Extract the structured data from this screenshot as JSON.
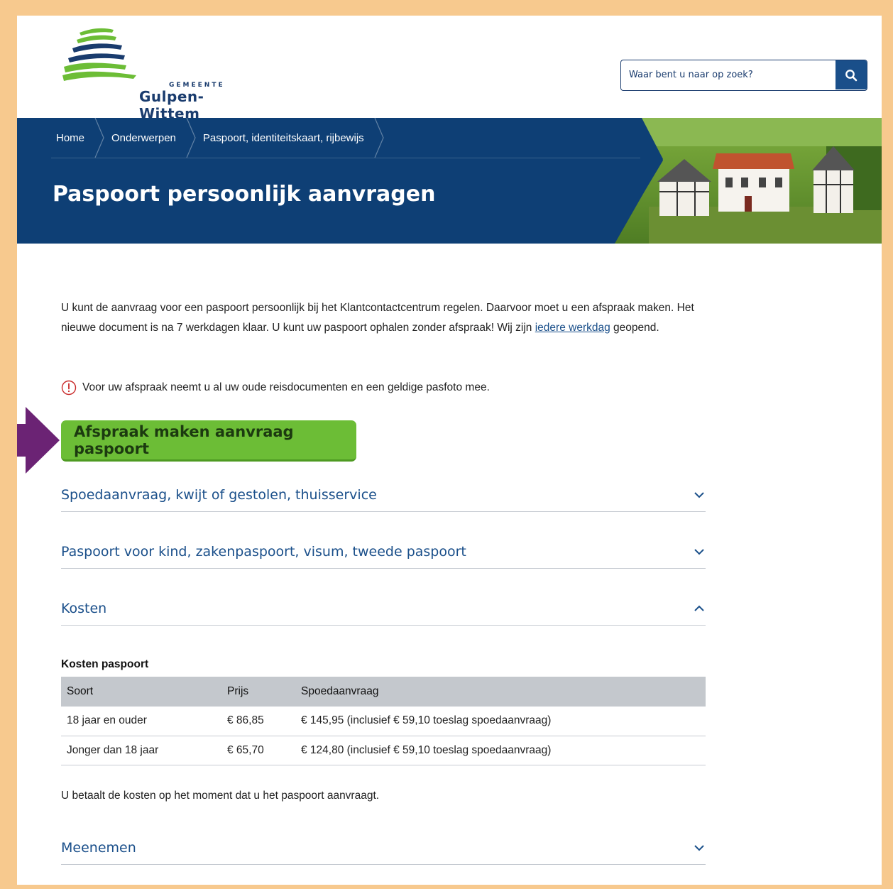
{
  "logo": {
    "gemeente": "GEMEENTE",
    "name": "Gulpen-Wittem"
  },
  "search": {
    "placeholder": "Waar bent u naar op zoek?"
  },
  "breadcrumb": [
    "Home",
    "Onderwerpen",
    "Paspoort, identiteitskaart, rijbewijs"
  ],
  "page_title": "Paspoort persoonlijk aanvragen",
  "intro": {
    "text_before": "U kunt de aanvraag voor een paspoort persoonlijk bij het Klantcontactcentrum regelen. Daarvoor moet u een afspraak maken. Het nieuwe document is na 7 werkdagen klaar. U kunt uw paspoort ophalen zonder afspraak! Wij zijn ",
    "link_text": "iedere werkdag",
    "text_after": " geopend."
  },
  "notice": "Voor uw afspraak neemt u al uw oude reisdocumenten en een geldige pasfoto mee.",
  "cta_label": "Afspraak maken aanvraag paspoort",
  "accordions": [
    {
      "title": "Spoedaanvraag, kwijt of gestolen, thuisservice",
      "state": "collapsed"
    },
    {
      "title": "Paspoort voor kind, zakenpaspoort, visum, tweede paspoort",
      "state": "collapsed"
    },
    {
      "title": "Kosten",
      "state": "expanded"
    },
    {
      "title": "Meenemen",
      "state": "collapsed"
    }
  ],
  "costs": {
    "caption": "Kosten paspoort",
    "headers": [
      "Soort",
      "Prijs",
      "Spoedaanvraag"
    ],
    "rows": [
      [
        "18 jaar en ouder",
        "€ 86,85",
        "€ 145,95 (inclusief € 59,10 toeslag spoedaanvraag)"
      ],
      [
        "Jonger dan 18 jaar",
        "€ 65,70",
        "€ 124,80 (inclusief € 59,10 toeslag spoedaanvraag)"
      ]
    ],
    "payment_note": "U betaalt de kosten op het moment dat u het paspoort aanvraagt."
  },
  "colors": {
    "navy": "#0e3f75",
    "link": "#1a4f8a",
    "cta_green": "#6cbd36",
    "frame": "#f7c98e",
    "arrow": "#6b2374"
  }
}
